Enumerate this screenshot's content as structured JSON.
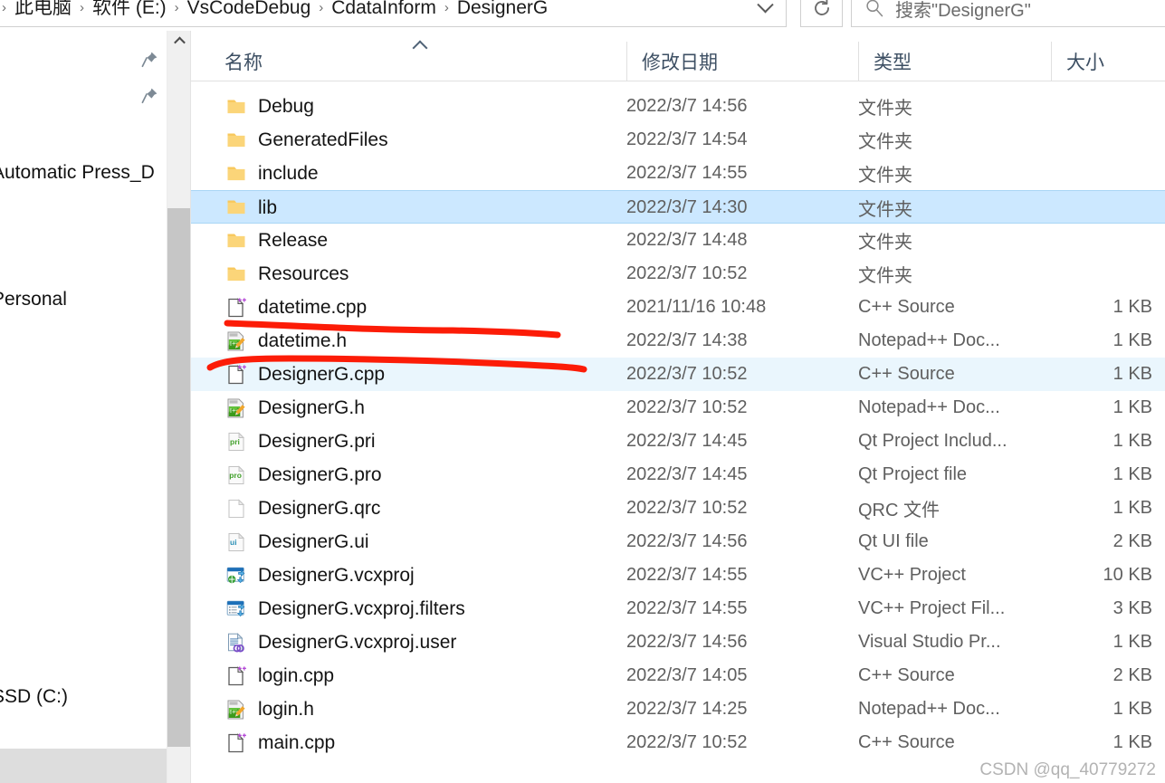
{
  "addressbar": {
    "breadcrumb": [
      "此电脑",
      "软件 (E:)",
      "VsCodeDebug",
      "CdataInform",
      "DesignerG"
    ],
    "separator": "›",
    "dropdown_icon": "chevron-down-icon",
    "refresh_icon": "refresh-icon",
    "search": {
      "placeholder": "搜索\"DesignerG\"",
      "icon": "search-icon"
    }
  },
  "navpane": {
    "items": [
      {
        "label": "Automatic Press_D",
        "pinned": true
      },
      {
        "label": "Personal",
        "pinned": true
      },
      {
        "label": "SSD (C:)",
        "pinned": false
      }
    ],
    "scrollbar": {
      "up_icon": "chevron-up-icon"
    }
  },
  "filelist": {
    "columns": [
      {
        "key": "name",
        "label": "名称"
      },
      {
        "key": "date",
        "label": "修改日期"
      },
      {
        "key": "type",
        "label": "类型"
      },
      {
        "key": "size",
        "label": "大小"
      }
    ],
    "sort_indicator": "chevron-up-icon",
    "rows": [
      {
        "name": "Debug",
        "date": "2022/3/7 14:56",
        "type": "文件夹",
        "size": "",
        "icon": "folder-icon",
        "state": "normal"
      },
      {
        "name": "GeneratedFiles",
        "date": "2022/3/7 14:54",
        "type": "文件夹",
        "size": "",
        "icon": "folder-icon",
        "state": "normal"
      },
      {
        "name": "include",
        "date": "2022/3/7 14:55",
        "type": "文件夹",
        "size": "",
        "icon": "folder-icon",
        "state": "normal"
      },
      {
        "name": "lib",
        "date": "2022/3/7 14:30",
        "type": "文件夹",
        "size": "",
        "icon": "folder-icon",
        "state": "selected"
      },
      {
        "name": "Release",
        "date": "2022/3/7 14:48",
        "type": "文件夹",
        "size": "",
        "icon": "folder-icon",
        "state": "normal"
      },
      {
        "name": "Resources",
        "date": "2022/3/7 10:52",
        "type": "文件夹",
        "size": "",
        "icon": "folder-icon",
        "state": "normal"
      },
      {
        "name": "datetime.cpp",
        "date": "2021/11/16 10:48",
        "type": "C++ Source",
        "size": "1 KB",
        "icon": "cpp-source-icon",
        "state": "normal"
      },
      {
        "name": "datetime.h",
        "date": "2022/3/7 14:38",
        "type": "Notepad++ Doc...",
        "size": "1 KB",
        "icon": "notepadpp-icon",
        "state": "normal"
      },
      {
        "name": "DesignerG.cpp",
        "date": "2022/3/7 10:52",
        "type": "C++ Source",
        "size": "1 KB",
        "icon": "cpp-source-icon",
        "state": "hover"
      },
      {
        "name": "DesignerG.h",
        "date": "2022/3/7 10:52",
        "type": "Notepad++ Doc...",
        "size": "1 KB",
        "icon": "notepadpp-icon",
        "state": "normal"
      },
      {
        "name": "DesignerG.pri",
        "date": "2022/3/7 14:45",
        "type": "Qt Project Includ...",
        "size": "1 KB",
        "icon": "qt-pri-icon",
        "state": "normal"
      },
      {
        "name": "DesignerG.pro",
        "date": "2022/3/7 14:45",
        "type": "Qt Project file",
        "size": "1 KB",
        "icon": "qt-pro-icon",
        "state": "normal"
      },
      {
        "name": "DesignerG.qrc",
        "date": "2022/3/7 10:52",
        "type": "QRC 文件",
        "size": "1 KB",
        "icon": "blank-file-icon",
        "state": "normal"
      },
      {
        "name": "DesignerG.ui",
        "date": "2022/3/7 14:56",
        "type": "Qt UI file",
        "size": "2 KB",
        "icon": "qt-ui-icon",
        "state": "normal"
      },
      {
        "name": "DesignerG.vcxproj",
        "date": "2022/3/7 14:55",
        "type": "VC++ Project",
        "size": "10 KB",
        "icon": "vcxproj-icon",
        "state": "normal"
      },
      {
        "name": "DesignerG.vcxproj.filters",
        "date": "2022/3/7 14:55",
        "type": "VC++ Project Fil...",
        "size": "3 KB",
        "icon": "vcxproj-filters-icon",
        "state": "normal"
      },
      {
        "name": "DesignerG.vcxproj.user",
        "date": "2022/3/7 14:56",
        "type": "Visual Studio Pr...",
        "size": "1 KB",
        "icon": "vcxproj-user-icon",
        "state": "normal"
      },
      {
        "name": "login.cpp",
        "date": "2022/3/7 14:05",
        "type": "C++ Source",
        "size": "2 KB",
        "icon": "cpp-source-icon",
        "state": "normal"
      },
      {
        "name": "login.h",
        "date": "2022/3/7 14:25",
        "type": "Notepad++ Doc...",
        "size": "1 KB",
        "icon": "notepadpp-icon",
        "state": "normal"
      },
      {
        "name": "main.cpp",
        "date": "2022/3/7 10:52",
        "type": "C++ Source",
        "size": "1 KB",
        "icon": "cpp-source-icon",
        "state": "normal"
      }
    ]
  },
  "annotations": {
    "marks": [
      {
        "name": "red-underline-datetime-cpp",
        "color": "#fc1c07"
      },
      {
        "name": "red-underline-datetime-h",
        "color": "#fc1c07"
      }
    ]
  },
  "watermark": {
    "text": "CSDN @qq_40779272"
  },
  "colors": {
    "selection": "#cce8ff",
    "hover": "#eaf6fd",
    "header_text": "#3d4f63",
    "annotation_red": "#fc1c07"
  }
}
